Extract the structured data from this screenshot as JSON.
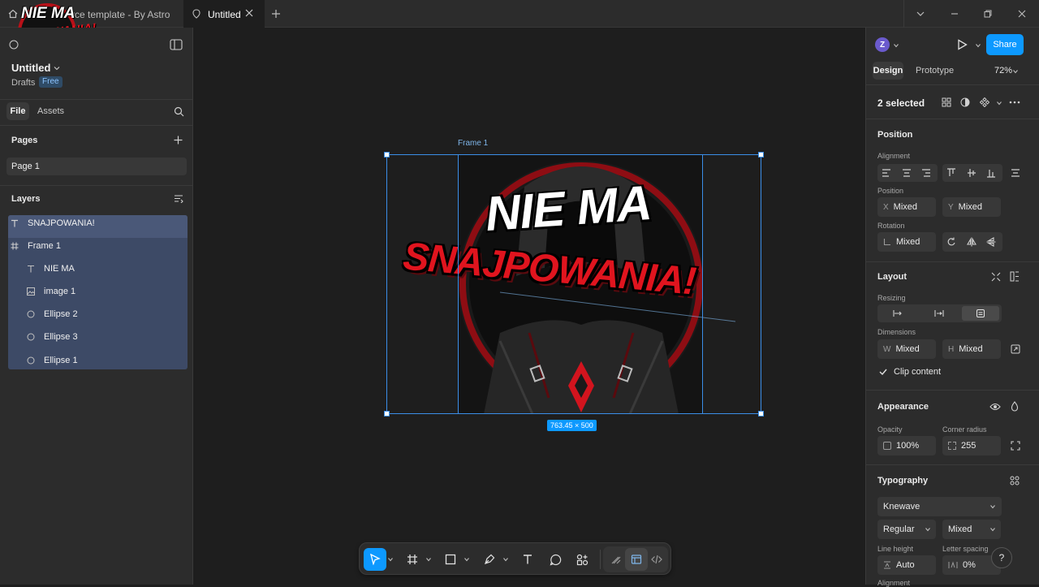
{
  "tabs": {
    "home_title": "rce template - By Astro",
    "active_title": "Untitled"
  },
  "overlay_logo": {
    "line1": "NIE MA",
    "line2": "SNAJPOWANIA!"
  },
  "file": {
    "name": "Untitled",
    "location": "Drafts",
    "plan_badge": "Free"
  },
  "left_tabs": {
    "file": "File",
    "assets": "Assets"
  },
  "pages": {
    "title": "Pages",
    "items": [
      "Page 1"
    ]
  },
  "layers": {
    "title": "Layers",
    "items": [
      {
        "name": "SNAJPOWANIA!",
        "type": "text"
      },
      {
        "name": "Frame 1",
        "type": "frame"
      },
      {
        "name": "NIE MA",
        "type": "text"
      },
      {
        "name": "image 1",
        "type": "image"
      },
      {
        "name": "Ellipse 2",
        "type": "ellipse"
      },
      {
        "name": "Ellipse 3",
        "type": "ellipse"
      },
      {
        "name": "Ellipse 1",
        "type": "ellipse"
      }
    ]
  },
  "canvas": {
    "frame_label": "Frame 1",
    "size_badge": "763.45 × 500",
    "art_text_top": "NIE MA",
    "art_text_bottom": "SNAJPOWANIA!"
  },
  "right": {
    "avatar_letter": "Z",
    "share": "Share",
    "tab_design": "Design",
    "tab_prototype": "Prototype",
    "zoom": "72%",
    "selection": "2 selected",
    "position": {
      "title": "Position",
      "alignment_label": "Alignment",
      "position_label": "Position",
      "x_prefix": "X",
      "x_value": "Mixed",
      "y_prefix": "Y",
      "y_value": "Mixed",
      "rotation_label": "Rotation",
      "rotation_value": "Mixed"
    },
    "layout": {
      "title": "Layout",
      "resizing_label": "Resizing",
      "dimensions_label": "Dimensions",
      "w_prefix": "W",
      "w_value": "Mixed",
      "h_prefix": "H",
      "h_value": "Mixed",
      "clip_content": "Clip content"
    },
    "appearance": {
      "title": "Appearance",
      "opacity_label": "Opacity",
      "opacity_value": "100%",
      "radius_label": "Corner radius",
      "radius_value": "255"
    },
    "typography": {
      "title": "Typography",
      "font": "Knewave",
      "weight": "Regular",
      "size": "Mixed",
      "line_height_label": "Line height",
      "line_height_value": "Auto",
      "letter_spacing_label": "Letter spacing",
      "letter_spacing_value": "0%",
      "alignment_label": "Alignment"
    },
    "help": "?"
  },
  "colors": {
    "accent": "#0d99ff",
    "brand_red": "#d2141e",
    "selection": "#3b8ee8"
  }
}
